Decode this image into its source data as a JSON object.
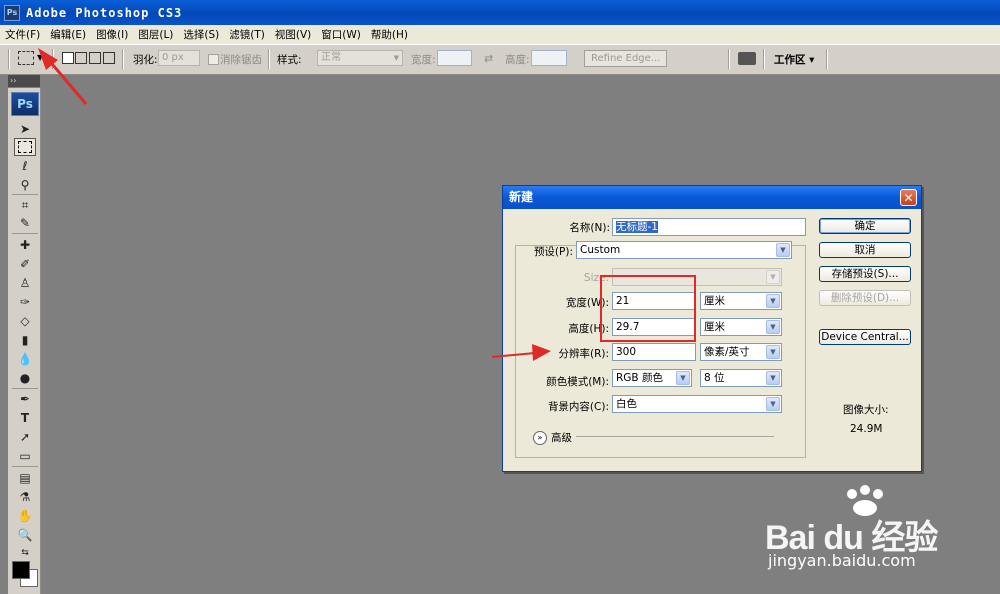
{
  "window": {
    "title": "Adobe Photoshop CS3",
    "icon": "Ps"
  },
  "menu": [
    "文件(F)",
    "编辑(E)",
    "图像(I)",
    "图层(L)",
    "选择(S)",
    "滤镜(T)",
    "视图(V)",
    "窗口(W)",
    "帮助(H)"
  ],
  "options": {
    "feather_label": "羽化:",
    "feather_value": "0 px",
    "antialias_label": "消除锯齿",
    "style_label": "样式:",
    "style_value": "正常",
    "width_label": "宽度:",
    "height_label": "高度:",
    "refine_edge": "Refine Edge...",
    "workspace": "工作区 ▾"
  },
  "toolbox": {
    "logo": "Ps"
  },
  "dialog": {
    "title": "新建",
    "name_label": "名称(N):",
    "name_value": "无标题-1",
    "preset_label": "预设(P):",
    "preset_value": "Custom",
    "size_label": "Size:",
    "width_label": "宽度(W):",
    "width_value": "21",
    "width_unit": "厘米",
    "height_label": "高度(H):",
    "height_value": "29.7",
    "height_unit": "厘米",
    "resolution_label": "分辨率(R):",
    "resolution_value": "300",
    "resolution_unit": "像素/英寸",
    "color_mode_label": "颜色模式(M):",
    "color_mode_value": "RGB 颜色",
    "bit_depth_value": "8 位",
    "background_label": "背景内容(C):",
    "background_value": "白色",
    "advanced_label": "高级",
    "buttons": {
      "ok": "确定",
      "cancel": "取消",
      "save_preset": "存储预设(S)...",
      "delete_preset": "删除预设(D)...",
      "device_central": "Device Central..."
    },
    "image_size_label": "图像大小:",
    "image_size_value": "24.9M"
  },
  "watermark": {
    "brand": "Bai du 经验",
    "url": "jingyan.baidu.com"
  },
  "colors": {
    "title_bar": "#0a5fd6",
    "annotation": "#e02a2a",
    "workspace": "#7f7f7f"
  }
}
